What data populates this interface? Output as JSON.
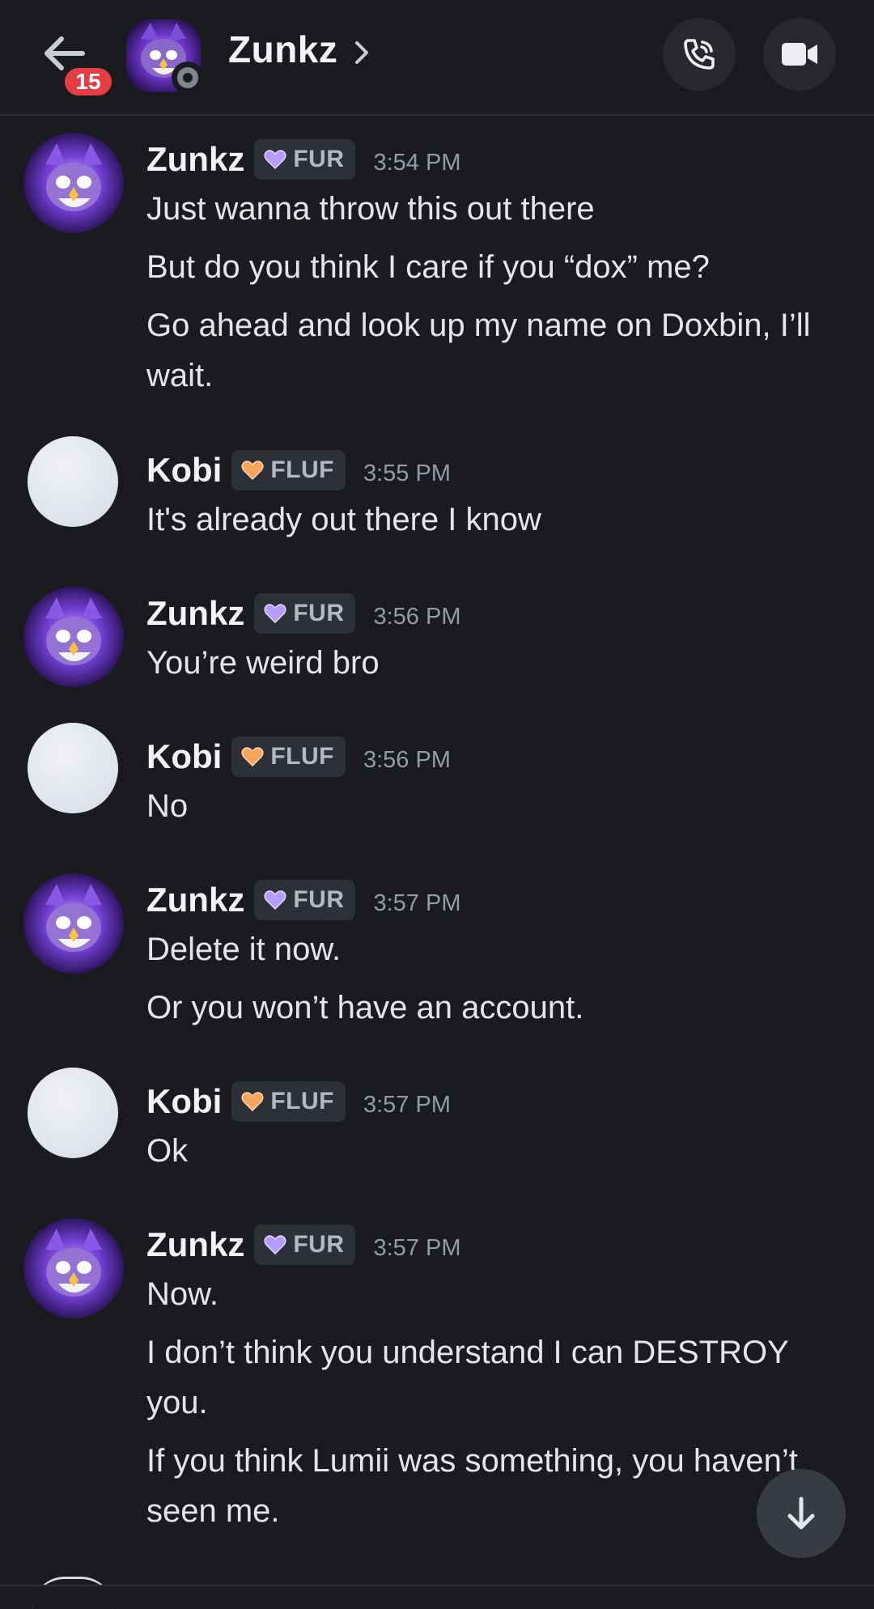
{
  "header": {
    "title": "Zunkz",
    "unread_count": "15",
    "back_icon": "arrow-left-icon",
    "call_icon": "phone-icon",
    "video_icon": "video-camera-icon"
  },
  "colors": {
    "background": "#1a1b1f",
    "badge_red": "#e53d44",
    "tag_bg": "#2e3037",
    "fur_heart": "#b79cff",
    "fluf_heart": "#f7a35c"
  },
  "messages": [
    {
      "author": "Zunkz",
      "tag": "FUR",
      "time": "3:54 PM",
      "lines": [
        "Just wanna throw this out there",
        "But do you think I care if you “dox” me?",
        "Go ahead and look up my name on Doxbin, I’ll wait."
      ]
    },
    {
      "author": "Kobi",
      "tag": "FLUF",
      "time": "3:55 PM",
      "lines": [
        "It's already out there I know"
      ]
    },
    {
      "author": "Zunkz",
      "tag": "FUR",
      "time": "3:56 PM",
      "lines": [
        "You’re weird bro"
      ]
    },
    {
      "author": "Kobi",
      "tag": "FLUF",
      "time": "3:56 PM",
      "lines": [
        "No"
      ]
    },
    {
      "author": "Zunkz",
      "tag": "FUR",
      "time": "3:57 PM",
      "lines": [
        "Delete it now.",
        "Or you won’t have an account."
      ]
    },
    {
      "author": "Kobi",
      "tag": "FLUF",
      "time": "3:57 PM",
      "lines": [
        "Ok"
      ]
    },
    {
      "author": "Zunkz",
      "tag": "FUR",
      "time": "3:57 PM",
      "lines": [
        "Now.",
        "I don’t think you understand I can DESTROY you.",
        "If you think Lumii was something, you haven’t seen me."
      ]
    }
  ],
  "scroll_icon": "arrow-down-icon"
}
